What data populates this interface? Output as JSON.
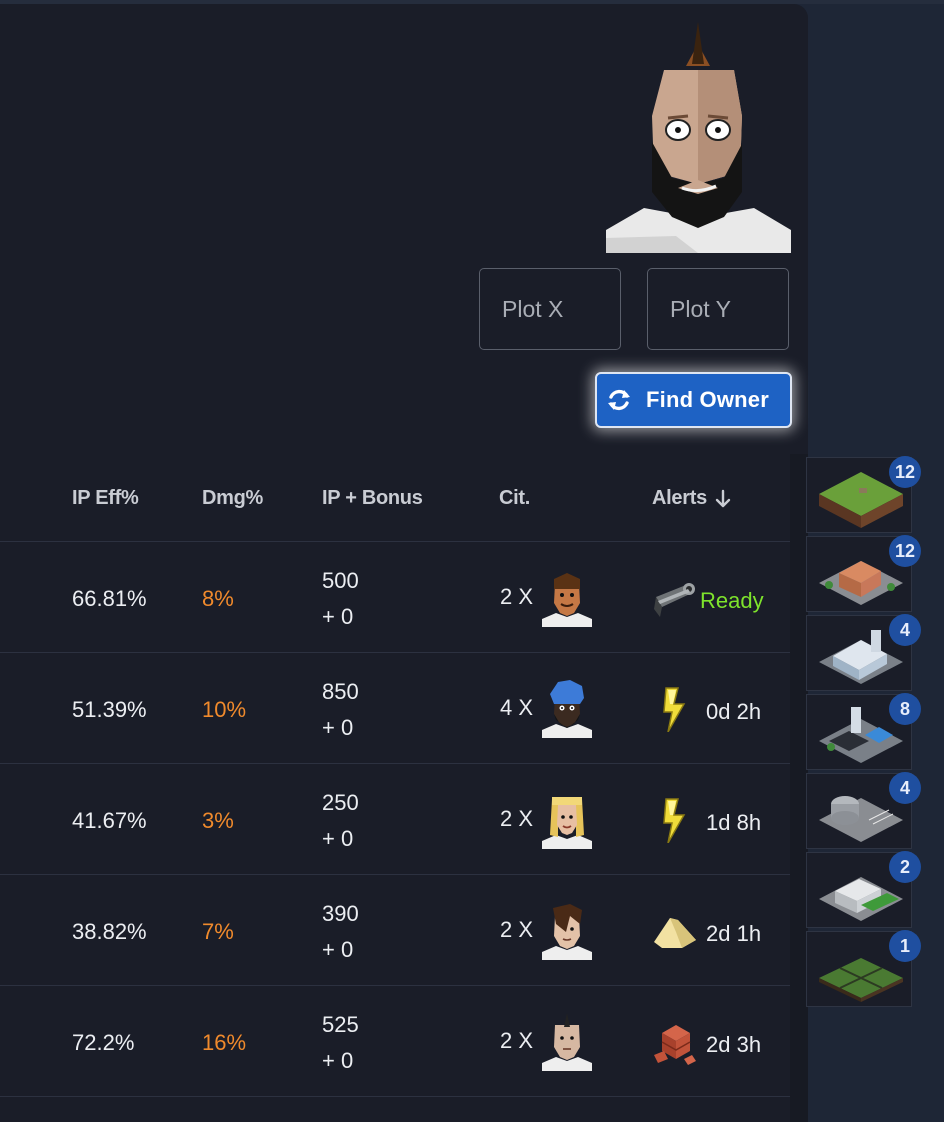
{
  "plot_inputs": {
    "x_placeholder": "Plot X",
    "y_placeholder": "Plot Y"
  },
  "find_button": {
    "label": "Find Owner",
    "icon": "sync-icon",
    "color": "#1e62c4"
  },
  "table": {
    "headers": {
      "ip_eff": "IP Eff%",
      "dmg": "Dmg%",
      "ip_bonus": "IP + Bonus",
      "cit": "Cit.",
      "alerts": "Alerts"
    },
    "sort": {
      "column": "alerts",
      "icon": "arrow-down-icon"
    },
    "rows": [
      {
        "ip_eff": "66.81%",
        "dmg": "8%",
        "ip": "500",
        "bonus": "+ 0",
        "cit": "2 X",
        "citizen_icon": "citizen-brown-hair-avatar-icon",
        "alert_icon": "pipe-icon",
        "alert": "Ready"
      },
      {
        "ip_eff": "51.39%",
        "dmg": "10%",
        "ip": "850",
        "bonus": "+ 0",
        "cit": "4 X",
        "citizen_icon": "citizen-blue-hair-avatar-icon",
        "alert_icon": "lightning-bolt-icon",
        "alert": "0d 2h"
      },
      {
        "ip_eff": "41.67%",
        "dmg": "3%",
        "ip": "250",
        "bonus": "+ 0",
        "cit": "2 X",
        "citizen_icon": "citizen-blonde-avatar-icon",
        "alert_icon": "lightning-bolt-icon",
        "alert": "1d 8h"
      },
      {
        "ip_eff": "38.82%",
        "dmg": "7%",
        "ip": "390",
        "bonus": "+ 0",
        "cit": "2 X",
        "citizen_icon": "citizen-brown-hair-avatar-icon",
        "alert_icon": "sand-pile-icon",
        "alert": "2d 1h"
      },
      {
        "ip_eff": "72.2%",
        "dmg": "16%",
        "ip": "525",
        "bonus": "+ 0",
        "cit": "2 X",
        "citizen_icon": "citizen-mohawk-avatar-icon",
        "alert_icon": "bricks-icon",
        "alert": "2d 3h"
      }
    ]
  },
  "side_panel": [
    {
      "icon": "grass-land-tile-icon",
      "count": "12"
    },
    {
      "icon": "residential-building-tile-icon",
      "count": "12"
    },
    {
      "icon": "industrial-building-tile-icon",
      "count": "4"
    },
    {
      "icon": "factory-building-tile-icon",
      "count": "8"
    },
    {
      "icon": "parking-building-tile-icon",
      "count": "4"
    },
    {
      "icon": "modern-house-tile-icon",
      "count": "2"
    },
    {
      "icon": "farmland-tile-icon",
      "count": "1"
    }
  ],
  "colors": {
    "background": "#1a1d28",
    "damage": "#f08a2c",
    "ready": "#7ee32c",
    "badge": "#1f4fa0"
  }
}
